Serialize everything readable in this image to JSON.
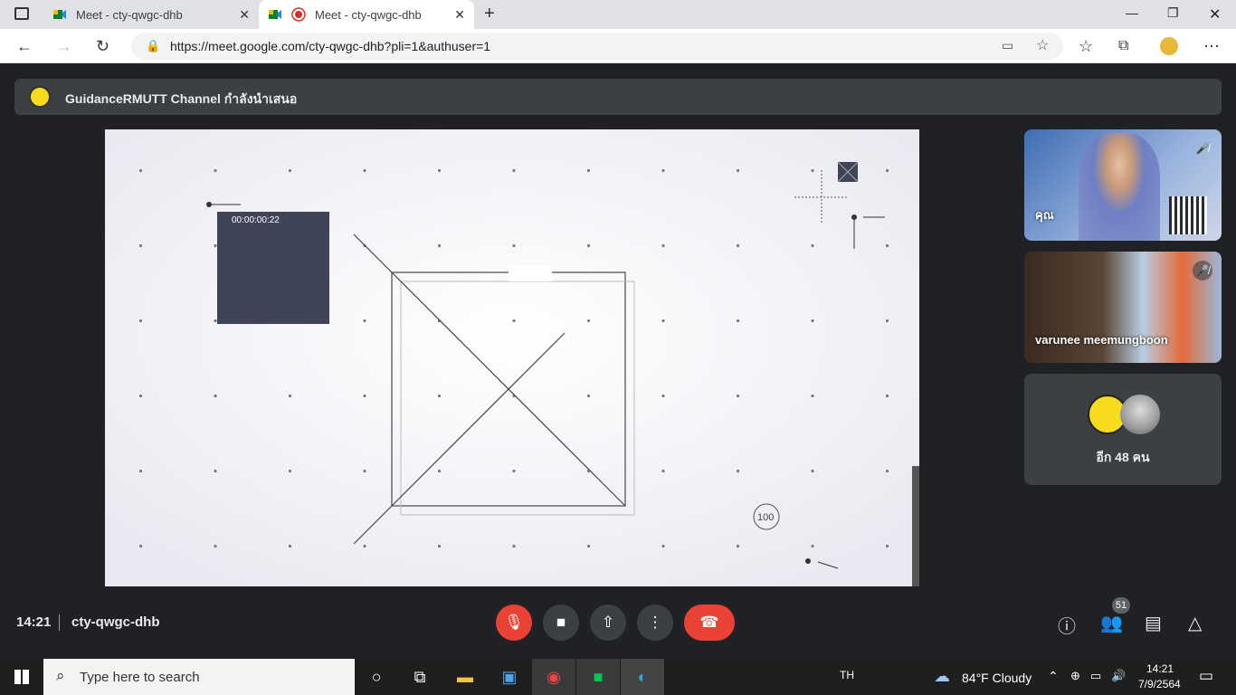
{
  "browser": {
    "tabs": [
      {
        "title": "Meet - cty-qwgc-dhb"
      },
      {
        "title": "Meet - cty-qwgc-dhb"
      }
    ],
    "url": "https://meet.google.com/cty-qwgc-dhb?pli=1&authuser=1"
  },
  "presentation_bar": {
    "presenter": "GuidanceRMUTT Channel กำลังนำเสนอ"
  },
  "stage": {
    "timer": "00:00:00:22",
    "counter": "100"
  },
  "participants": [
    {
      "name": "คุณ",
      "muted": true
    },
    {
      "name": "varunee meemungboon",
      "muted": true
    }
  ],
  "more_participants": "อีก 48 คน",
  "meeting": {
    "time": "14:21",
    "code": "cty-qwgc-dhb",
    "participant_count": "51"
  },
  "taskbar": {
    "search_placeholder": "Type here to search",
    "lang": "TH",
    "weather": "84°F  Cloudy",
    "time": "14:21",
    "date": "7/9/2564"
  }
}
